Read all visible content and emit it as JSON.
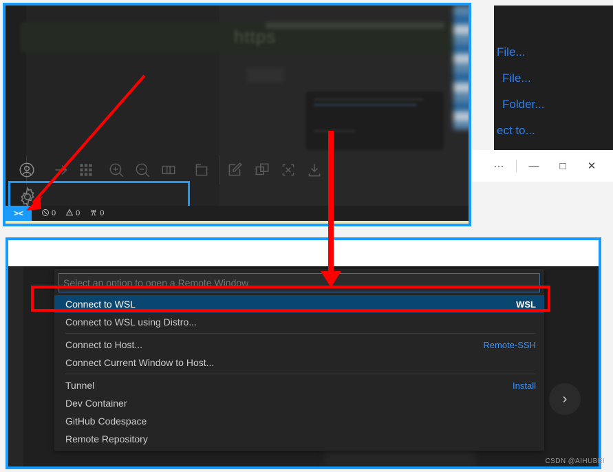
{
  "top_window": {
    "blurred_url_text": "https",
    "toolbar_icons": [
      "account-icon",
      "arrow-right-icon",
      "grid-icon",
      "zoom-in-icon",
      "zoom-out-icon",
      "split-editor-icon",
      "open-panel-icon",
      "edit-icon",
      "copy-window-icon",
      "close-all-icon",
      "download-icon"
    ],
    "settings_icon": "gear-icon",
    "status_bar": {
      "remote_indicator": "><",
      "errors": "0",
      "warnings": "0",
      "ports": "0",
      "error_icon": "error-circle-icon",
      "warning_icon": "warning-triangle-icon",
      "ports_icon": "radio-tower-icon"
    }
  },
  "welcome_links": [
    "File...",
    "File...",
    "Folder...",
    "ect to..."
  ],
  "window_controls": {
    "more": "···",
    "minimize": "—",
    "maximize": "□",
    "close": "✕"
  },
  "quick_pick": {
    "placeholder": "Select an option to open a Remote Window",
    "value": "",
    "items": [
      {
        "label": "Connect to WSL",
        "right": "WSL",
        "right_kind": "kbd",
        "selected": true,
        "separator_after": false
      },
      {
        "label": "Connect to WSL using Distro...",
        "right": "",
        "right_kind": "none",
        "selected": false,
        "separator_after": true
      },
      {
        "label": "Connect to Host...",
        "right": "Remote-SSH",
        "right_kind": "link",
        "selected": false,
        "separator_after": false
      },
      {
        "label": "Connect Current Window to Host...",
        "right": "",
        "right_kind": "none",
        "selected": false,
        "separator_after": true
      },
      {
        "label": "Tunnel",
        "right": "Install",
        "right_kind": "link",
        "selected": false,
        "separator_after": false
      },
      {
        "label": "Dev Container",
        "right": "",
        "right_kind": "none",
        "selected": false,
        "separator_after": false
      },
      {
        "label": "GitHub Codespace",
        "right": "",
        "right_kind": "none",
        "selected": false,
        "separator_after": false
      },
      {
        "label": "Remote Repository",
        "right": "",
        "right_kind": "none",
        "selected": false,
        "separator_after": false
      }
    ]
  },
  "next_button": "›",
  "watermark": "CSDN @AIHUBEI",
  "colors": {
    "annotation_blue": "#1a9bfc",
    "annotation_red": "#ff0000",
    "selection_blue": "#094771",
    "link_blue": "#3794ff",
    "editor_bg": "#1f1f1f",
    "quickpick_bg": "#252526"
  }
}
